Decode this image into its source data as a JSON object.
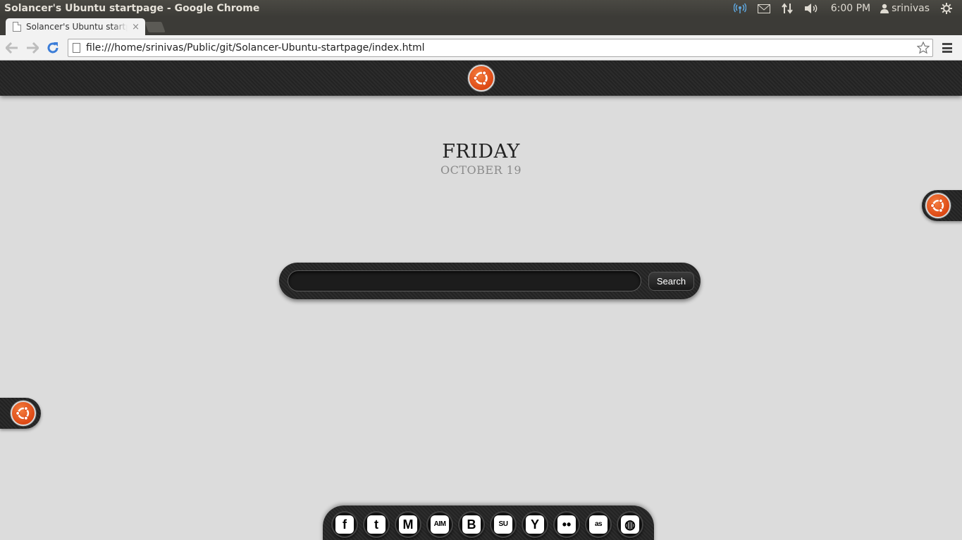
{
  "panel": {
    "window_title": "Solancer's Ubuntu startpage - Google Chrome",
    "clock": "6:00 PM",
    "user": "srinivas",
    "indicators": [
      "network-wireless-icon",
      "mail-icon",
      "transfer-icon",
      "volume-icon",
      "user-icon",
      "power-gear-icon"
    ]
  },
  "browser": {
    "tab_title": "Solancer's Ubuntu startpage - Google Chrome",
    "tab_close": "×",
    "url": "file:///home/srinivas/Public/git/Solancer-Ubuntu-startpage/index.html"
  },
  "page": {
    "day": "FRIDAY",
    "date": "OCTOBER 19",
    "search": {
      "placeholder": "",
      "value": "",
      "button_label": "Search"
    },
    "social": [
      {
        "name": "facebook",
        "glyph": "f"
      },
      {
        "name": "twitter",
        "glyph": "t"
      },
      {
        "name": "gmail",
        "glyph": "M"
      },
      {
        "name": "aim",
        "glyph": "AIM"
      },
      {
        "name": "blogger",
        "glyph": "B"
      },
      {
        "name": "stumbleupon",
        "glyph": "SU"
      },
      {
        "name": "yahoo",
        "glyph": "Y"
      },
      {
        "name": "flickr",
        "glyph": "••"
      },
      {
        "name": "lastfm",
        "glyph": "as"
      },
      {
        "name": "picasa",
        "glyph": "◍"
      }
    ],
    "colors": {
      "ubuntu_orange": "#dd4814",
      "background": "#dcdcdc",
      "bar_dark": "#262626"
    }
  }
}
